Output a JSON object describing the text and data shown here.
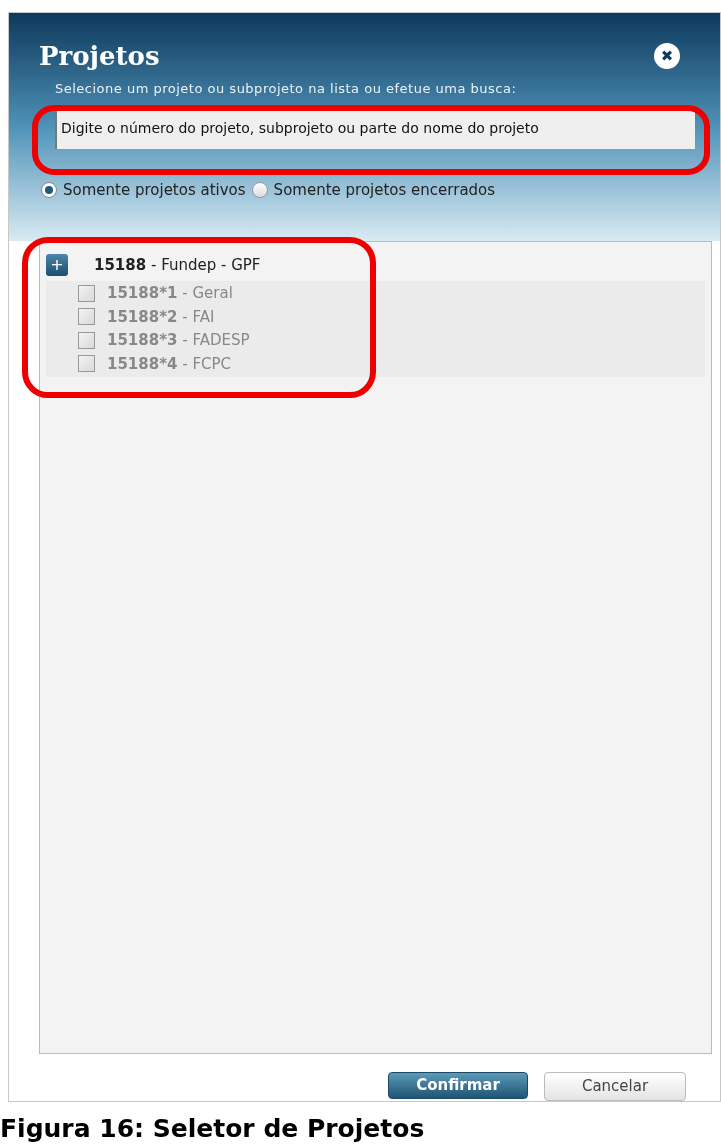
{
  "dialog": {
    "title": "Projetos",
    "close": "✖",
    "instruction": "Selecione um projeto ou subprojeto na lista ou efetue uma busca:",
    "search": {
      "placeholder": "Digite o número do projeto, subprojeto ou parte do nome do projeto"
    },
    "filters": [
      {
        "label": "Somente projetos ativos",
        "selected": true
      },
      {
        "label": "Somente projetos encerrados",
        "selected": false
      }
    ],
    "tree": [
      {
        "toggle": "+",
        "code": "15188",
        "name": " - Fundep - GPF",
        "children": [
          {
            "code": "15188*1",
            "name": " - Geral",
            "checked": false
          },
          {
            "code": "15188*2",
            "name": " - FAI",
            "checked": false
          },
          {
            "code": "15188*3",
            "name": " - FADESP",
            "checked": false
          },
          {
            "code": "15188*4",
            "name": " - FCPC",
            "checked": false
          }
        ]
      }
    ],
    "buttons": [
      {
        "label": "Confirmar",
        "kind": "primary"
      },
      {
        "label": "Cancelar",
        "kind": "secondary"
      }
    ]
  },
  "caption": "Figura 16: Seletor de Projetos"
}
